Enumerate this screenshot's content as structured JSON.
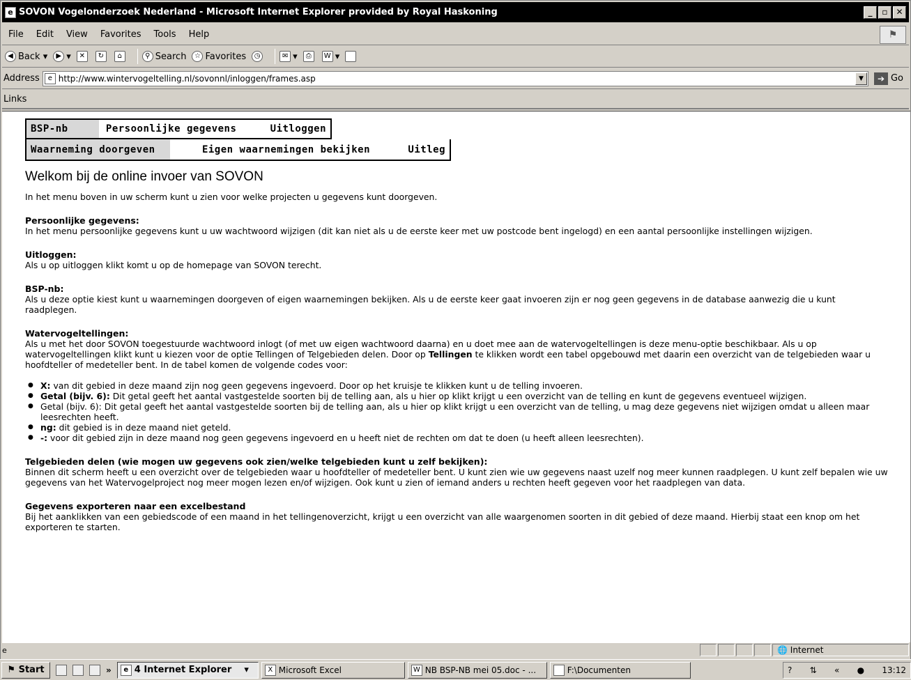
{
  "window": {
    "title": "SOVON Vogelonderzoek Nederland - Microsoft Internet Explorer provided by Royal Haskoning"
  },
  "menu": [
    "File",
    "Edit",
    "View",
    "Favorites",
    "Tools",
    "Help"
  ],
  "toolbar": {
    "back": "Back",
    "search": "Search",
    "favorites": "Favorites"
  },
  "address": {
    "label": "Address",
    "url": "http://www.wintervogeltelling.nl/sovonnl/inloggen/frames.asp",
    "go": "Go"
  },
  "links_label": "Links",
  "nav1": [
    "BSP-nb",
    "Persoonlijke gegevens",
    "Uitloggen"
  ],
  "nav2": [
    "Waarneming doorgeven",
    "Eigen waarnemingen bekijken",
    "Uitleg"
  ],
  "page": {
    "heading": "Welkom bij de online invoer van SOVON",
    "intro": "In het menu boven in uw scherm kunt u zien voor welke projecten u gegevens kunt doorgeven.",
    "s1_title": "Persoonlijke gegevens:",
    "s1_text": "In het menu persoonlijke gegevens kunt u uw wachtwoord wijzigen (dit kan niet als u de eerste keer met uw postcode bent ingelogd) en een aantal persoonlijke instellingen wijzigen.",
    "s2_title": "Uitloggen:",
    "s2_text": "Als u op uitloggen klikt komt u op de homepage van SOVON terecht.",
    "s3_title": "BSP-nb:",
    "s3_text": "Als u deze optie kiest kunt u waarnemingen doorgeven of eigen waarnemingen bekijken. Als u de eerste keer gaat invoeren zijn er nog geen gegevens in de database aanwezig die u kunt raadplegen.",
    "s4_title": "Watervogeltellingen:",
    "s4_text_a": "Als u met het door SOVON toegestuurde wachtwoord inlogt (of met uw eigen wachtwoord daarna) en u doet mee aan de watervogeltellingen is deze menu-optie beschikbaar. Als u op watervogeltellingen klikt kunt u kiezen voor de optie Tellingen of Telgebieden delen. Door op ",
    "s4_text_bold": "Tellingen",
    "s4_text_b": " te klikken wordt een tabel opgebouwd met daarin een overzicht van de telgebieden waar u hoofdteller of medeteller bent. In de tabel komen de volgende codes voor:",
    "bullets": [
      {
        "b": "X:",
        "t": " van dit gebied in deze maand zijn nog geen gegevens ingevoerd. Door op het kruisje te klikken kunt u de telling invoeren."
      },
      {
        "b": "Getal (bijv. 6):",
        "t": " Dit getal geeft het aantal vastgestelde soorten bij de telling aan, als u hier op klikt krijgt u een overzicht van de telling en kunt de gegevens eventueel wijzigen."
      },
      {
        "b": "",
        "t": "Getal (bijv. 6): Dit getal geeft het aantal vastgestelde soorten bij de telling aan, als u hier op klikt krijgt u een overzicht van de telling, u mag deze gegevens niet wijzigen omdat u alleen maar leesrechten heeft."
      },
      {
        "b": "ng:",
        "t": " dit gebied is in deze maand niet geteld."
      },
      {
        "b": "-:",
        "t": " voor dit gebied zijn in deze maand nog geen gegevens ingevoerd en u heeft niet de rechten om dat te doen (u heeft alleen leesrechten)."
      }
    ],
    "s5_title": "Telgebieden delen (wie mogen uw gegevens ook zien/welke telgebieden kunt u zelf bekijken):",
    "s5_text": "Binnen dit scherm heeft u een overzicht over de telgebieden waar u hoofdteller of medeteller bent. U kunt zien wie uw gegevens naast uzelf nog meer kunnen raadplegen. U kunt zelf bepalen wie uw gegevens van het Watervogelproject nog meer mogen lezen en/of wijzigen. Ook kunt u zien of iemand anders u rechten heeft gegeven voor het raadplegen van data.",
    "s6_title": "Gegevens exporteren naar een excelbestand",
    "s6_text": "Bij het aanklikken van een gebiedscode of een maand in het tellingenoverzicht, krijgt u een overzicht van alle waargenomen soorten in dit gebied of deze maand. Hierbij staat een knop om het exporteren te starten."
  },
  "status": {
    "zone": "Internet"
  },
  "taskbar": {
    "start": "Start",
    "chevron": "»",
    "tasks": [
      "4 Internet Explorer",
      "Microsoft Excel",
      "NB BSP-NB mei 05.doc - ...",
      "F:\\Documenten"
    ],
    "clock": "13:12"
  }
}
